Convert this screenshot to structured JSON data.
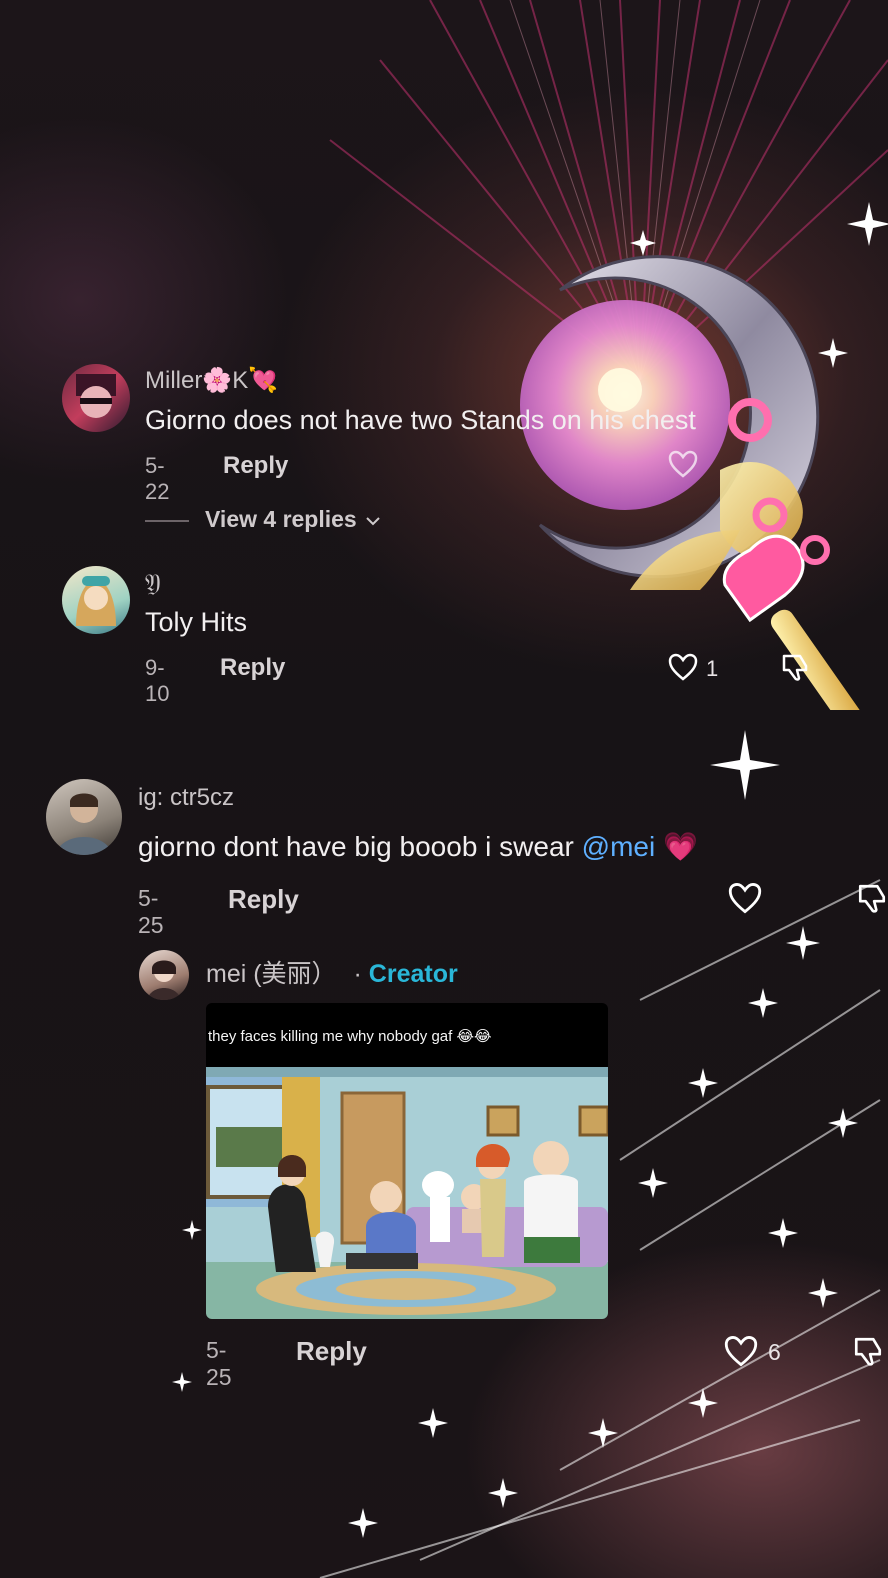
{
  "comments": [
    {
      "username": "Miller🌸K💘",
      "text": "Giorno does not have two Stands on his chest",
      "date": "5-22",
      "reply_label": "Reply",
      "view_replies": "View 4 replies"
    },
    {
      "username": "𝔜",
      "text": "Toly Hits",
      "date": "9-10",
      "reply_label": "Reply",
      "likes": "1"
    },
    {
      "username": "ig: ctr5cz",
      "text": "giorno dont have big booob i swear",
      "mention": "@mei",
      "emoji": "💗",
      "date": "5-25",
      "reply_label": "Reply"
    }
  ],
  "reply": {
    "username": "mei (美丽）",
    "separator": "·",
    "badge": "Creator",
    "media_caption": "they faces killing me why nobody gaf 😂😂",
    "date": "5-25",
    "reply_label": "Reply",
    "likes": "6"
  },
  "icons": {
    "like": "heart-outline-icon",
    "dislike": "thumbs-down-outline-icon",
    "expand": "chevron-down-icon"
  },
  "colors": {
    "mention": "#5fb0ff",
    "creator_badge": "#2ab7d8",
    "text": "#f2eff0",
    "secondary": "#b9b3b6"
  }
}
